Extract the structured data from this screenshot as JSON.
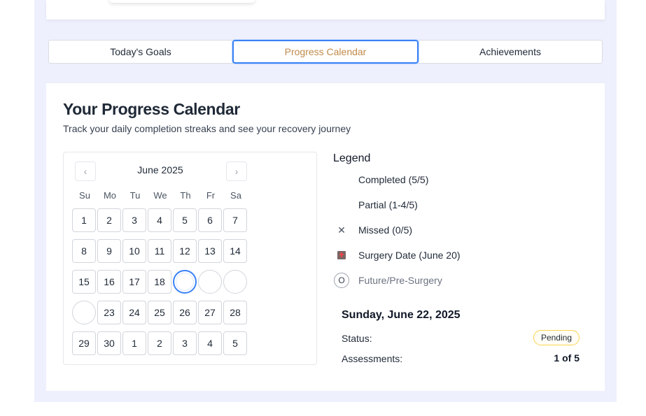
{
  "tabs": [
    {
      "label": "Today's Goals"
    },
    {
      "label": "Progress Calendar",
      "active": true
    },
    {
      "label": "Achievements"
    }
  ],
  "page": {
    "title": "Your Progress Calendar",
    "subtitle": "Track your daily completion streaks and see your recovery journey"
  },
  "calendar": {
    "month_label": "June 2025",
    "prev_icon": "chevron-left-icon",
    "next_icon": "chevron-right-icon",
    "weekdays": [
      "Su",
      "Mo",
      "Tu",
      "We",
      "Th",
      "Fr",
      "Sa"
    ],
    "weeks": [
      [
        {
          "d": "1"
        },
        {
          "d": "2"
        },
        {
          "d": "3"
        },
        {
          "d": "4"
        },
        {
          "d": "5"
        },
        {
          "d": "6"
        },
        {
          "d": "7"
        }
      ],
      [
        {
          "d": "8"
        },
        {
          "d": "9"
        },
        {
          "d": "10"
        },
        {
          "d": "11"
        },
        {
          "d": "12"
        },
        {
          "d": "13"
        },
        {
          "d": "14"
        }
      ],
      [
        {
          "d": "15"
        },
        {
          "d": "16"
        },
        {
          "d": "17"
        },
        {
          "d": "18"
        },
        {
          "d": "",
          "s": "today"
        },
        {
          "d": "",
          "s": "circle"
        },
        {
          "d": "",
          "s": "circle"
        }
      ],
      [
        {
          "d": "",
          "s": "circle"
        },
        {
          "d": "23"
        },
        {
          "d": "24"
        },
        {
          "d": "25"
        },
        {
          "d": "26"
        },
        {
          "d": "27"
        },
        {
          "d": "28"
        }
      ],
      [
        {
          "d": "29"
        },
        {
          "d": "30"
        },
        {
          "d": "1"
        },
        {
          "d": "2"
        },
        {
          "d": "3"
        },
        {
          "d": "4"
        },
        {
          "d": "5"
        }
      ]
    ]
  },
  "legend": {
    "title": "Legend",
    "items": [
      {
        "icon": "completed-icon",
        "label": "Completed (5/5)"
      },
      {
        "icon": "partial-icon",
        "label": "Partial (1-4/5)"
      },
      {
        "icon": "x-icon",
        "glyph": "✕",
        "label": "Missed (0/5)"
      },
      {
        "icon": "hospital-icon",
        "label": "Surgery Date (June 20)"
      },
      {
        "icon": "circle-o-icon",
        "glyph": "O",
        "label": "Future/Pre-Surgery"
      }
    ]
  },
  "detail": {
    "date": "Sunday, June 22, 2025",
    "status_label": "Status:",
    "status_value": "Pending",
    "assessments_label": "Assessments:",
    "assessments_value": "1 of 5"
  },
  "colors": {
    "accent": "#3b82f6",
    "active_tab_text": "#c08a4a",
    "pending_border": "#fcd34d",
    "background": "#eef0fd"
  }
}
